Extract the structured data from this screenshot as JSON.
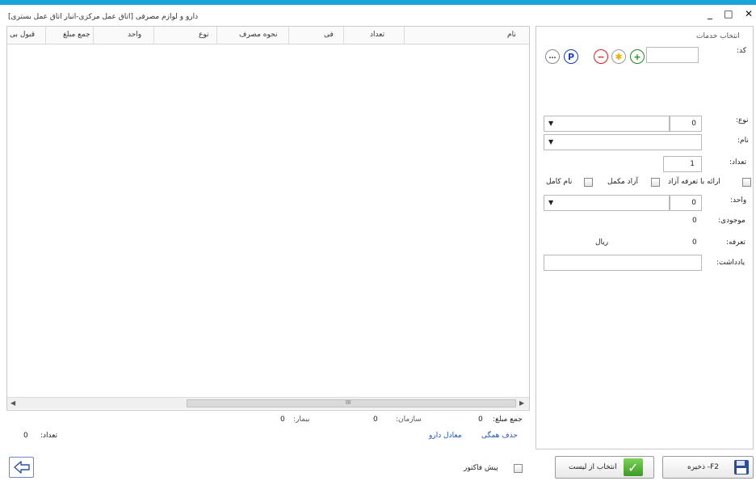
{
  "window": {
    "title": "دارو و لوازم مصرفی [اتاق عمل مرکزی-انبار اتاق عمل بستری]",
    "minimize": "_",
    "maximize": "□",
    "close": "✕"
  },
  "services": {
    "title": "انتخاب خدمات",
    "code_label": "کد:",
    "type_label": "نوع:",
    "type_value": "0",
    "name_label": "نام:",
    "count_label": "تعداد:",
    "count_value": "1",
    "free_tariff_label": "ارائه با تعرفه آزاد",
    "free_supplement_label": "آزاد مکمل",
    "full_name_label": "نام کامل",
    "unit_label": "واحد:",
    "unit_value": "0",
    "stock_label": "موجودی:",
    "stock_value": "0",
    "tariff_label": "تعرفه:",
    "tariff_value": "0",
    "currency": "ریال",
    "note_label": "یادداشت:"
  },
  "table": {
    "columns": [
      "نام",
      "تعداد",
      "فی",
      "نحوه مصرف",
      "نوع",
      "واحد",
      "جمع مبلغ",
      "قبول بی"
    ],
    "rows": [],
    "scroll_mark": "III"
  },
  "summary": {
    "total_label": "جمع مبلغ:",
    "total_value": "0",
    "org_label": "سازمان:",
    "org_value": "0",
    "patient_label": "بیمار:",
    "patient_value": "0",
    "delete_all": "حذف همگی",
    "drug_equivalent": "معادل دارو",
    "count_label": "تعداد:",
    "count_value": "0"
  },
  "footer": {
    "save_label": "F2- ذخیره",
    "select_from_list_label": "انتخاب از لیست",
    "pre_invoice_label": "پیش فاکتور"
  },
  "colors": {
    "accent": "#1aa3d9",
    "link": "#1a53b8",
    "plus": "#1f8a1f",
    "minus": "#d81e1e",
    "star": "#e6b400",
    "p": "#1c3fb3"
  }
}
